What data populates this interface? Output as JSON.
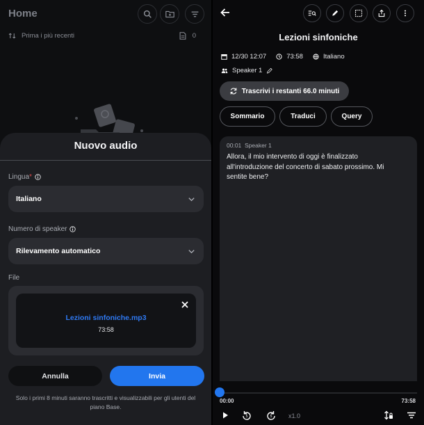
{
  "left": {
    "home_title": "Home",
    "sort_label": "Prima i più recenti",
    "file_count": "0",
    "sheet": {
      "title": "Nuovo audio",
      "language_label": "Lingua",
      "language_required_mark": "*",
      "language_value": "Italiano",
      "speaker_label": "Numero di speaker",
      "speaker_value": "Rilevamento automatico",
      "file_label": "File",
      "file_name": "Lezioni sinfoniche.mp3",
      "file_duration": "73:58",
      "cancel_label": "Annulla",
      "confirm_label": "Invia",
      "footnote": "Solo i primi 8 minuti saranno trascritti e visualizzabili per gli utenti del piano Base."
    }
  },
  "right": {
    "title": "Lezioni sinfoniche",
    "meta": {
      "datetime": "12/30 12:07",
      "duration": "73:58",
      "language": "Italiano"
    },
    "speaker": "Speaker 1",
    "transcribe_label": "Trascrivi i restanti 66.0 minuti",
    "tabs": [
      "Sommario",
      "Traduci",
      "Query"
    ],
    "transcript": {
      "timestamp": "00:01",
      "speaker": "Speaker 1",
      "text": "Allora, il mio intervento di oggi è finalizzato all'introduzione del concerto di sabato prossimo. Mi sentite bene?"
    },
    "player": {
      "current_time": "00:00",
      "total_time": "73:58",
      "speed": "x1.0",
      "progress_fraction": 0
    }
  },
  "colors": {
    "accent": "#2276ee",
    "required": "#e04b4b",
    "sheet_bg": "#1d1e22",
    "field_bg": "#2b2c31"
  },
  "icons": [
    "search-icon",
    "folder-add-icon",
    "filter-icon",
    "sort-icon",
    "document-icon",
    "info-icon",
    "chevron-down-icon",
    "close-icon",
    "back-arrow-icon",
    "transcript-search-icon",
    "pencil-icon",
    "select-area-icon",
    "share-icon",
    "more-vertical-icon",
    "calendar-icon",
    "clock-icon",
    "globe-icon",
    "people-icon",
    "refresh-icon",
    "play-icon",
    "rewind-icon",
    "forward-icon",
    "text-size-icon",
    "filter-lines-icon"
  ]
}
